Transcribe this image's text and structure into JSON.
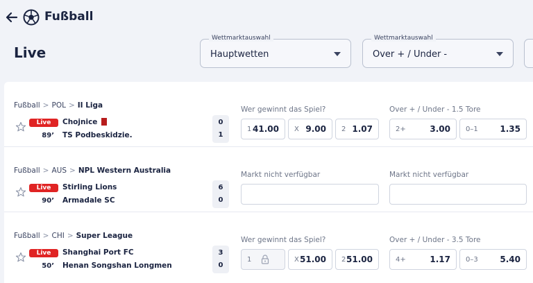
{
  "header": {
    "sport_title": "Fußball",
    "page_title": "Live"
  },
  "selects": [
    {
      "legend": "Wettmarktauswahl",
      "value": "Hauptwetten"
    },
    {
      "legend": "Wettmarktauswahl",
      "value": "Over + / Under -"
    }
  ],
  "matches": [
    {
      "breadcrumb": {
        "sport": "Fußball",
        "country": "POL",
        "league": "II Liga"
      },
      "live_badge": "Live",
      "minute": "89’",
      "team1": "Chojnice",
      "team2": "TS Podbeskidzie.",
      "score1": "0",
      "score2": "1",
      "market1": {
        "label": "Wer gewinnt das Spiel?",
        "odds": [
          {
            "key": "1",
            "value": "41.00"
          },
          {
            "key": "X",
            "value": "9.00"
          },
          {
            "key": "2",
            "value": "1.07"
          }
        ]
      },
      "market2": {
        "label": "Over + / Under - 1.5 Tore",
        "odds": [
          {
            "key": "2+",
            "value": "3.00"
          },
          {
            "key": "0–1",
            "value": "1.35"
          }
        ]
      }
    },
    {
      "breadcrumb": {
        "sport": "Fußball",
        "country": "AUS",
        "league": "NPL Western Australia"
      },
      "live_badge": "Live",
      "minute": "90’",
      "team1": "Stirling Lions",
      "team2": "Armadale SC",
      "score1": "6",
      "score2": "0",
      "market1": {
        "label": "Markt nicht verfügbar"
      },
      "market2": {
        "label": "Markt nicht verfügbar"
      }
    },
    {
      "breadcrumb": {
        "sport": "Fußball",
        "country": "CHI",
        "league": "Super League"
      },
      "live_badge": "Live",
      "minute": "50’",
      "team1": "Shanghai Port FC",
      "team2": "Henan Songshan Longmen",
      "score1": "3",
      "score2": "0",
      "market1": {
        "label": "Wer gewinnt das Spiel?",
        "odds": [
          {
            "key": "1",
            "value": ""
          },
          {
            "key": "X",
            "value": "51.00"
          },
          {
            "key": "2",
            "value": "51.00"
          }
        ]
      },
      "market2": {
        "label": "Over + / Under - 3.5 Tore",
        "odds": [
          {
            "key": "4+",
            "value": "1.17"
          },
          {
            "key": "0–3",
            "value": "5.40"
          }
        ]
      }
    }
  ],
  "icons": {
    "back": "arrow-left-icon",
    "sport": "football-icon",
    "favorite": "star-icon",
    "lock": "lock-icon",
    "dropdown": "caret-down-icon"
  },
  "colors": {
    "live": "#e02424",
    "red_card": "#b71c1c",
    "text": "#1a2340",
    "background": "#f1f3f8"
  }
}
